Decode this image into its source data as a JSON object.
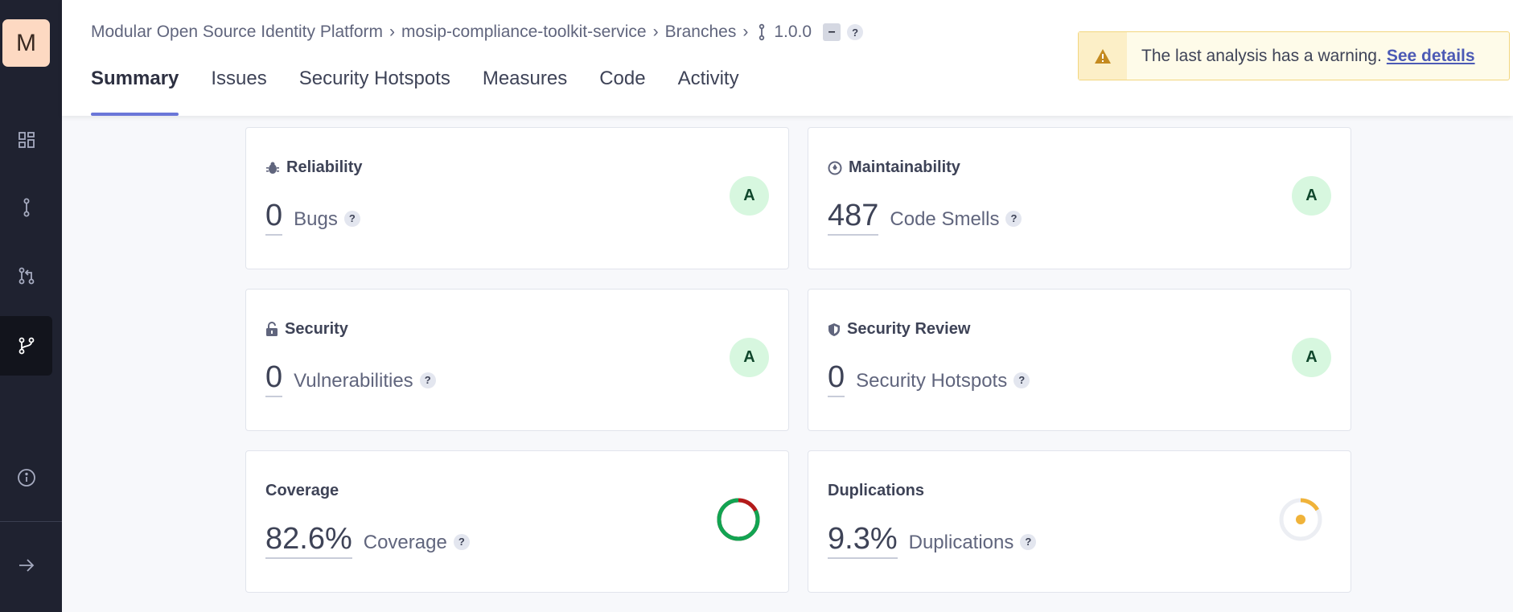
{
  "sidebar": {
    "avatar_letter": "M",
    "items": [
      {
        "name": "projects-icon"
      },
      {
        "name": "branch-icon"
      },
      {
        "name": "pull-request-icon"
      },
      {
        "name": "branches-icon"
      },
      {
        "name": "info-icon"
      },
      {
        "name": "expand-icon"
      }
    ]
  },
  "breadcrumb": {
    "org": "Modular Open Source Identity Platform",
    "project": "mosip-compliance-toolkit-service",
    "section": "Branches",
    "version": "1.0.0",
    "collapse": "–",
    "help": "?"
  },
  "tabs": [
    {
      "label": "Summary",
      "active": true
    },
    {
      "label": "Issues"
    },
    {
      "label": "Security Hotspots"
    },
    {
      "label": "Measures"
    },
    {
      "label": "Code"
    },
    {
      "label": "Activity"
    }
  ],
  "warning": {
    "text": "The last analysis has a warning.",
    "link": "See details"
  },
  "cards": {
    "reliability": {
      "title": "Reliability",
      "value": "0",
      "label": "Bugs",
      "rating": "A"
    },
    "maintainability": {
      "title": "Maintainability",
      "value": "487",
      "label": "Code Smells",
      "rating": "A"
    },
    "security": {
      "title": "Security",
      "value": "0",
      "label": "Vulnerabilities",
      "rating": "A"
    },
    "security_review": {
      "title": "Security Review",
      "value": "0",
      "label": "Security Hotspots",
      "rating": "A"
    },
    "coverage": {
      "title": "Coverage",
      "value": "82.6%",
      "label": "Coverage",
      "percent": 82.6
    },
    "duplications": {
      "title": "Duplications",
      "value": "9.3%",
      "label": "Duplications",
      "percent": 9.3
    }
  },
  "help": "?",
  "colors": {
    "sidebar": "#1f2230",
    "accent": "#6a76d8",
    "rating_bg": "#d7f7df",
    "coverage_good": "#12a452",
    "coverage_bad": "#b31a1a",
    "duplication": "#f0b33a"
  }
}
